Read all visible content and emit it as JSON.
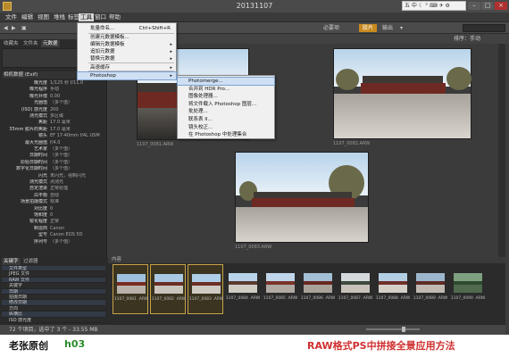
{
  "window": {
    "title": "20131107"
  },
  "tray": {
    "text": "五 中 ☾ ° ⌨ ✈ ⚙"
  },
  "menubar": [
    "文件",
    "编辑",
    "视图",
    "堆栈",
    "标签",
    "工具",
    "窗口",
    "帮助"
  ],
  "toolbar": {
    "workspace_active": "胶片",
    "workspace_items": [
      "必要项",
      "输出"
    ],
    "right_label": "排序：手动"
  },
  "left_panel": {
    "tabs": [
      "收藏夹",
      "文件夹",
      "元数据"
    ],
    "metadata_header": "相机数据 (Exif)",
    "metadata": [
      {
        "k": "曝光度",
        "v": "1/125 秒 f/11.0"
      },
      {
        "k": "曝光程序",
        "v": "手动"
      },
      {
        "k": "曝光补偿",
        "v": "0.00"
      },
      {
        "k": "光圈值",
        "v": "（多个值）"
      },
      {
        "k": "(ISO) 感光度",
        "v": "200"
      },
      {
        "k": "测光模式",
        "v": "多区域"
      },
      {
        "k": "焦距",
        "v": "17.0 毫米"
      },
      {
        "k": "35mm 胶片的焦距",
        "v": "17.0 毫米"
      },
      {
        "k": "镜头",
        "v": "EF 17-40mm f/4L USM"
      },
      {
        "k": "最大光圈值",
        "v": "f/4.0"
      },
      {
        "k": "艺术家",
        "v": "（多个值）"
      },
      {
        "k": "日期时间",
        "v": "（多个值）"
      },
      {
        "k": "原始日期时间",
        "v": "（多个值）"
      },
      {
        "k": "数字化日期时间",
        "v": "（多个值）"
      },
      {
        "k": "闪光",
        "v": "未闪光，强制闪光"
      },
      {
        "k": "测光模式",
        "v": "点测光"
      },
      {
        "k": "自定渲染",
        "v": "正常处理"
      },
      {
        "k": "白平衡",
        "v": "自动"
      },
      {
        "k": "场景拍摄模式",
        "v": "标准"
      },
      {
        "k": "对比度",
        "v": "0"
      },
      {
        "k": "饱和度",
        "v": "0"
      },
      {
        "k": "锐化程度",
        "v": "正常"
      },
      {
        "k": "制造商",
        "v": "Canon"
      },
      {
        "k": "型号",
        "v": "Canon EOS 5D"
      },
      {
        "k": "序列号",
        "v": "（多个值）"
      }
    ]
  },
  "bottom_panel": {
    "tabs": [
      "关键字",
      "过滤器"
    ],
    "rows": [
      "文件类型",
      "JPEG 文件",
      "RAW 文件",
      "关键字",
      "日期",
      "拍摄日期",
      "修改日期",
      "方向",
      "纵横比",
      "ISO 感光度"
    ]
  },
  "tools_menu": {
    "items": [
      {
        "label": "批量命名...",
        "shortcut": "Ctrl+Shift+R",
        "arrow": false
      },
      {
        "label": "创建元数据模板...",
        "shortcut": "",
        "arrow": false
      },
      {
        "label": "编辑元数据模板",
        "shortcut": "",
        "arrow": true
      },
      {
        "label": "追加元数据",
        "shortcut": "",
        "arrow": true
      },
      {
        "label": "替换元数据",
        "shortcut": "",
        "arrow": true
      },
      {
        "label": "高速缓存",
        "shortcut": "",
        "arrow": true
      },
      {
        "label": "Photoshop",
        "shortcut": "",
        "arrow": true
      }
    ]
  },
  "photoshop_submenu": {
    "items": [
      "Photomerge...",
      "合并到 HDR Pro...",
      "图像处理器...",
      "将文件载入 Photoshop 图层...",
      "批处理...",
      "联系表 II...",
      "镜头校正...",
      "在 Photoshop 中处理集合"
    ]
  },
  "content": {
    "captions": [
      "1107_0081.ARW",
      "1107_0082.ARW",
      "1107_0083.ARW"
    ]
  },
  "filmstrip": {
    "label": "内容",
    "items": [
      "1107_0081 .ARW",
      "1107_0082 .ARW",
      "1107_0083 .ARW",
      "1107_0084 .ARW",
      "1107_0085 .ARW",
      "1107_0086 .ARW",
      "1107_0087 .ARW",
      "1107_0088 .ARW",
      "1107_0089 .ARW",
      "1107_0090 .ARW"
    ]
  },
  "status": {
    "text": "72 个项目，选中了 3 个 - 33.55 MB"
  },
  "footer": {
    "left": "老张原创",
    "code": "h03",
    "right": "RAW格式PS中拼接全景应用方法"
  },
  "colors": {
    "accent": "#c8891e",
    "menu_highlight": "#cfe0f4",
    "footer_red": "#d03030",
    "footer_green": "#2a8a2a"
  }
}
